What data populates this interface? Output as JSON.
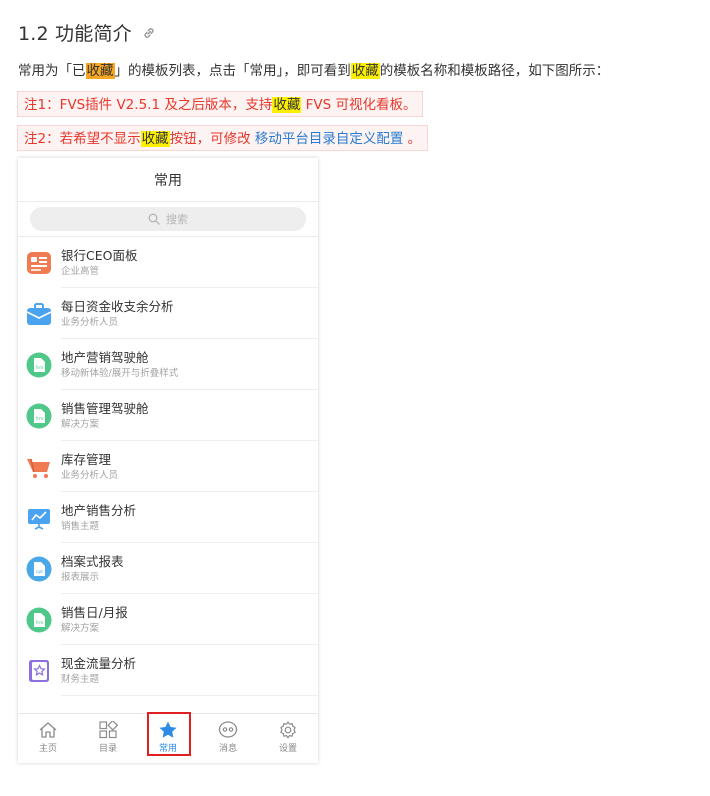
{
  "heading": {
    "title": "1.2 功能简介"
  },
  "intro": {
    "p1": "常用为「已",
    "hl1": "收藏",
    "p2": "」的模板列表，点击「常用」，即可看到",
    "hl2": "收藏",
    "p3": "的模板名称和模板路径，如下图所示："
  },
  "note1": {
    "p1": "注1：FVS插件 V2.5.1 及之后版本，支持",
    "hl": "收藏",
    "p2": " FVS 可视化看板。"
  },
  "note2": {
    "p1": "注2：若希望不显示",
    "hl": "收藏",
    "p2": "按钮，可修改 ",
    "link": "移动平台目录自定义配置",
    "p3": " 。"
  },
  "phone": {
    "title": "常用",
    "search_placeholder": "搜索",
    "items": [
      {
        "title": "银行CEO面板",
        "subtitle": "企业高管",
        "icon": "dashboard-icon",
        "color": "#f07b53"
      },
      {
        "title": "每日资金收支余分析",
        "subtitle": "业务分析人员",
        "icon": "briefcase-icon",
        "color": "#3d9be9"
      },
      {
        "title": "地产营销驾驶舱",
        "subtitle": "移动新体验/展开与折叠样式",
        "icon": "frm-file-icon",
        "color": "#4fc88a"
      },
      {
        "title": "销售管理驾驶舱",
        "subtitle": "解决方案",
        "icon": "frm-file-icon",
        "color": "#4fc88a"
      },
      {
        "title": "库存管理",
        "subtitle": "业务分析人员",
        "icon": "cart-icon",
        "color": "#f07b53"
      },
      {
        "title": "地产销售分析",
        "subtitle": "销售主题",
        "icon": "presentation-icon",
        "color": "#3d9be9"
      },
      {
        "title": "档案式报表",
        "subtitle": "报表展示",
        "icon": "cpt-file-icon",
        "color": "#4aa8e8"
      },
      {
        "title": "销售日/月报",
        "subtitle": "解决方案",
        "icon": "frm-file-icon",
        "color": "#4fc88a"
      },
      {
        "title": "现金流量分析",
        "subtitle": "财务主题",
        "icon": "star-book-icon",
        "color": "#8e6fe0"
      }
    ],
    "tabs": [
      {
        "label": "主页",
        "icon": "home-icon"
      },
      {
        "label": "目录",
        "icon": "catalog-icon"
      },
      {
        "label": "常用",
        "icon": "star-icon"
      },
      {
        "label": "消息",
        "icon": "message-icon"
      },
      {
        "label": "设置",
        "icon": "gear-icon"
      }
    ],
    "active_tab": "常用",
    "accent": "#2f8be6"
  }
}
